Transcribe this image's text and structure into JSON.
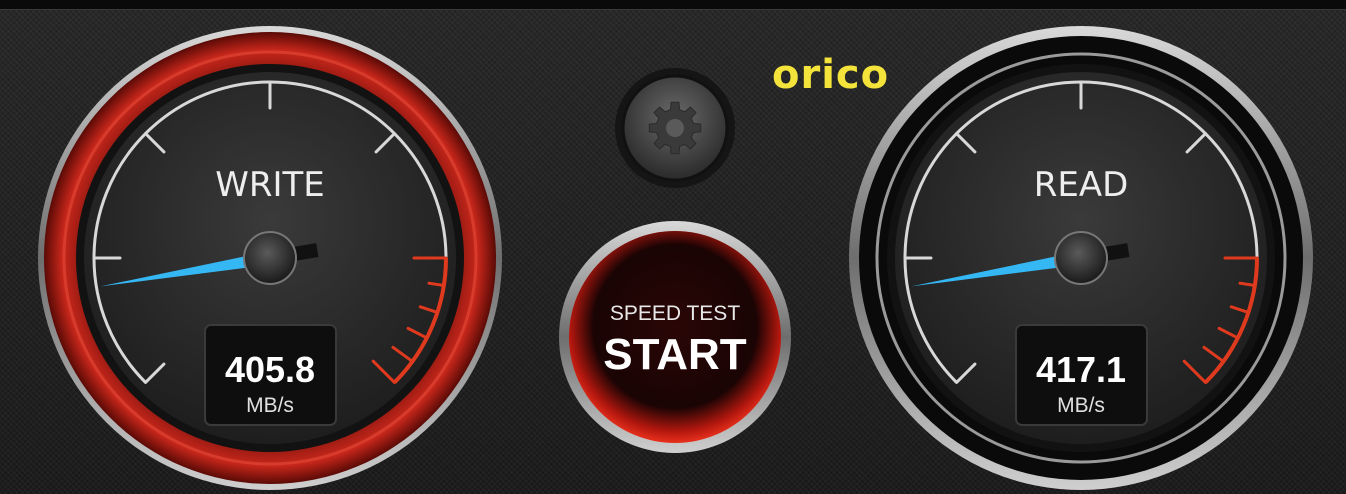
{
  "brand": {
    "text": "orico",
    "color": "#f3e33a"
  },
  "settings_button": {
    "icon": "gear-icon"
  },
  "start_button": {
    "subtitle": "SPEED TEST",
    "label": "START"
  },
  "gauges": {
    "write": {
      "title": "WRITE",
      "value": "405.8",
      "unit": "MB/s",
      "ring_color": "#c0261b"
    },
    "read": {
      "title": "READ",
      "value": "417.1",
      "unit": "MB/s",
      "ring_color": "#8a8a8a"
    }
  },
  "colors": {
    "needle": "#35b7f4",
    "redzone": "#e03a1e",
    "ticks": "#d8d8d8"
  }
}
